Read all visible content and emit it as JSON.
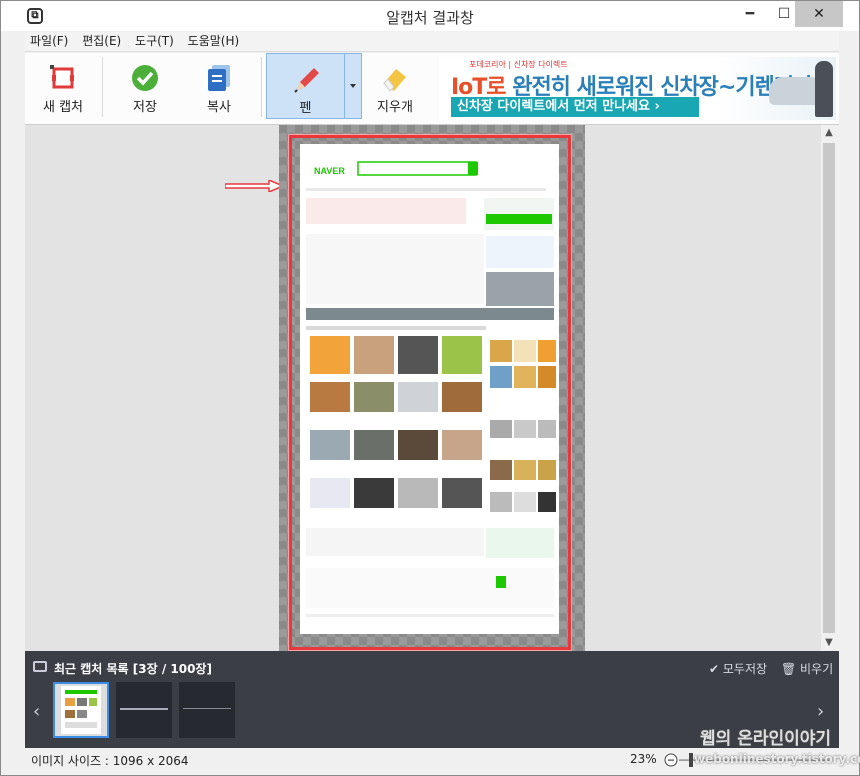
{
  "window": {
    "title": "알캡처 결과창",
    "minimize": "━",
    "maximize": "☐",
    "close": "✕"
  },
  "menu": [
    "파일(F)",
    "편집(E)",
    "도구(T)",
    "도움말(H)"
  ],
  "toolbar": {
    "new_capture": "새 캡처",
    "save": "저장",
    "copy": "복사",
    "pen": "펜",
    "eraser": "지우개"
  },
  "ad": {
    "small": "포데코리아 | 신차장 다이렉트",
    "main_prefix": "IoT로",
    "main_rest": " 완전히 새로워진 신차장~기렌터카",
    "sub": "신차장 다이렉트에서 먼저 만나세요 ›"
  },
  "naver": {
    "logo": "NAVER"
  },
  "recent": {
    "title": "최근 캡처 목록 [3장 / 100장]",
    "save_all": "✔ 모두저장",
    "clear": "🗑 비우기",
    "prev": "‹",
    "next": "›"
  },
  "status": {
    "image_size": "이미지 사이즈 : 1096 x 2064",
    "zoom": "23%"
  },
  "watermark": {
    "line1": "웹의 온라인이야기",
    "line2": "webonlinestory.tistory.com"
  },
  "colors": {
    "accent": "#e8383c",
    "pen_active": "#cde2f7",
    "naver_green": "#1ec800"
  }
}
